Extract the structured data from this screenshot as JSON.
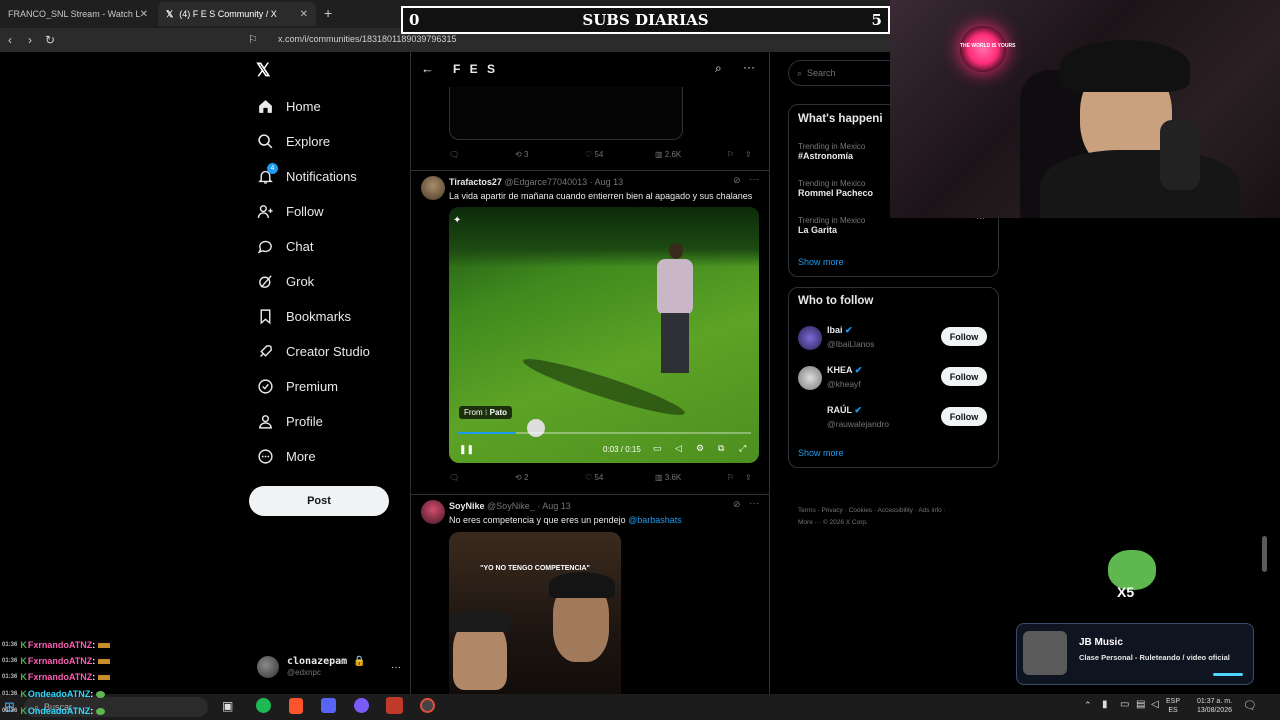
{
  "browser": {
    "tabs": [
      {
        "label": "FRANCO_SNL Stream - Watch Live on"
      },
      {
        "label": "(4) F E S Community / X"
      }
    ],
    "url": "x.com/i/communities/1831801189039796315"
  },
  "overlay": {
    "subs_left": "0",
    "subs_title": "SUBS DIARIAS",
    "subs_right": "5",
    "neon_sign": "THE WORLD IS YOURS",
    "emote_count": "X5"
  },
  "nav": {
    "items": [
      {
        "label": "Home",
        "icon": "home-icon"
      },
      {
        "label": "Explore",
        "icon": "search-icon"
      },
      {
        "label": "Notifications",
        "icon": "bell-icon",
        "badge": "4"
      },
      {
        "label": "Follow",
        "icon": "follow-icon"
      },
      {
        "label": "Chat",
        "icon": "chat-icon"
      },
      {
        "label": "Grok",
        "icon": "grok-icon"
      },
      {
        "label": "Bookmarks",
        "icon": "bookmark-icon"
      },
      {
        "label": "Creator Studio",
        "icon": "rocket-icon"
      },
      {
        "label": "Premium",
        "icon": "premium-icon"
      },
      {
        "label": "Profile",
        "icon": "person-icon"
      },
      {
        "label": "More",
        "icon": "more-icon"
      }
    ],
    "post_label": "Post",
    "account_name": "clonazepam",
    "account_handle": "@edxnpc"
  },
  "community": {
    "title": "F E S"
  },
  "tweets": [
    {
      "retweets": "3",
      "likes": "54",
      "views": "2.6K"
    },
    {
      "author": "Tirafactos27",
      "handle": "@Edgarce77040013",
      "date": "· Aug 13",
      "text": "La vida apartir de mañana cuando entierren bien al apagado y sus chalanes",
      "video_from_label": "From",
      "video_from_name": "Pato",
      "video_time": "0:03 / 0:15",
      "video_progress": 0.2,
      "retweets": "2",
      "likes": "54",
      "views": "3.6K"
    },
    {
      "author": "SoyNike",
      "handle": "@SoyNike_",
      "date": "· Aug 13",
      "text": "No eres competencia y que eres un pendejo",
      "mention": "@barbashats",
      "media_caption": "\"YO NO TENGO COMPETENCIA\""
    }
  ],
  "sidebar": {
    "search_placeholder": "Search",
    "trends_title": "What's happeni",
    "trends": [
      {
        "context": "Trending in Mexico",
        "name": "#Astronomía"
      },
      {
        "context": "Trending in Mexico",
        "name": "Rommel Pacheco"
      },
      {
        "context": "Trending in Mexico",
        "name": "La Garita"
      }
    ],
    "show_more": "Show more",
    "who_to_follow_title": "Who to follow",
    "follow_suggestions": [
      {
        "name": "Ibai",
        "handle": "@IbaiLlanos"
      },
      {
        "name": "KHEA",
        "handle": "@kheayf"
      },
      {
        "name": "RAÚL",
        "handle": "@rauwalejandro"
      }
    ],
    "follow_label": "Follow",
    "show_more_2": "Show more",
    "footer_links": [
      "Terms",
      "Privacy",
      "Cookies",
      "Accessibility",
      "Ads info"
    ],
    "footer_more": "More ···",
    "footer_copyright": "© 2026 X Corp."
  },
  "music_widget": {
    "title": "JB Music",
    "subtitle": "Clase Personal - Ruleteando / video oficial"
  },
  "chat": [
    {
      "time": "01:36",
      "user": "FxrnandoATNZ",
      "color": "#ff5cb5"
    },
    {
      "time": "01:36",
      "user": "FxrnandoATNZ",
      "color": "#ff5cb5"
    },
    {
      "time": "01:36",
      "user": "FxrnandoATNZ",
      "color": "#ff5cb5"
    },
    {
      "time": "01:36",
      "user": "OndeadoATNZ",
      "color": "#2fd7ff"
    },
    {
      "time": "01:36",
      "user": "OndeadoATNZ",
      "color": "#2fd7ff"
    }
  ],
  "taskbar": {
    "search_placeholder": "Buscar",
    "lang_top": "ESP",
    "lang_bottom": "ES",
    "time": "01:37 a. m.",
    "date": "13/08/2026"
  },
  "colors": {
    "accent": "#1d9bf0",
    "background": "#000000",
    "border": "#2f3336",
    "muted": "#71767b"
  }
}
